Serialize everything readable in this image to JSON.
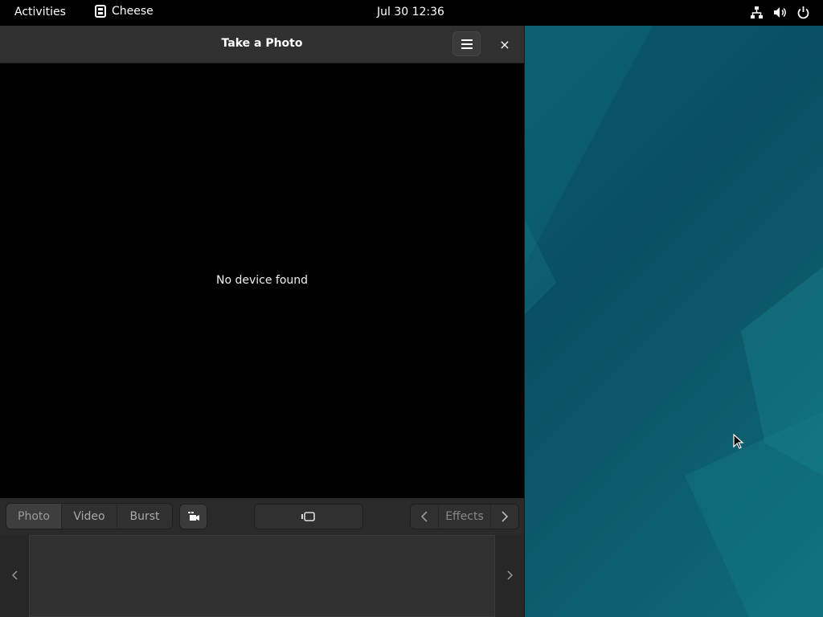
{
  "topbar": {
    "activities": "Activities",
    "app_name": "Cheese",
    "clock": "Jul 30  12:36",
    "tray_icons": [
      "network-icon",
      "volume-icon",
      "power-icon"
    ]
  },
  "window": {
    "title": "Take a Photo",
    "close_label": "×",
    "message": "No device found",
    "modes": [
      "Photo",
      "Video",
      "Burst"
    ],
    "active_mode": "Photo",
    "effects_label": "Effects"
  },
  "colors": {
    "topbar": "#000000",
    "headerbar": "#303030",
    "viewport": "#000000",
    "desktop": "#0b5a6e"
  }
}
